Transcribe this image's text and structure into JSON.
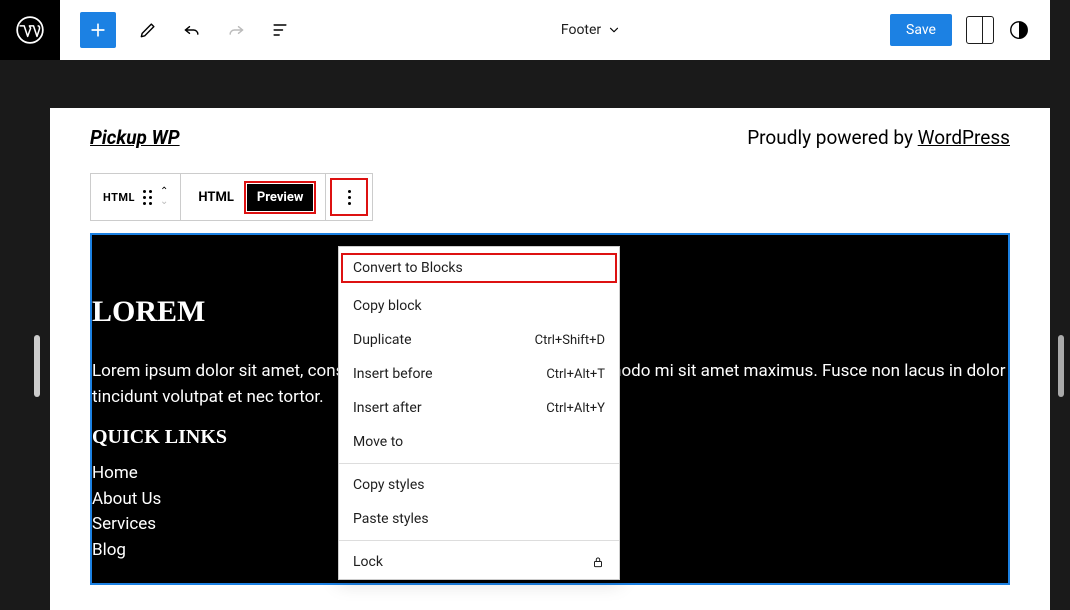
{
  "topbar": {
    "title_label": "Footer",
    "save_label": "Save"
  },
  "site": {
    "title": "Pickup WP",
    "powered_prefix": "Proudly powered by ",
    "powered_link": "WordPress"
  },
  "toolbar": {
    "type_label": "HTML",
    "html_btn": "HTML",
    "preview_btn": "Preview"
  },
  "menu": {
    "items": [
      {
        "label": "Convert to Blocks",
        "kbd": "",
        "highlight": true
      },
      {
        "label": "Copy block",
        "kbd": ""
      },
      {
        "label": "Duplicate",
        "kbd": "Ctrl+Shift+D"
      },
      {
        "label": "Insert before",
        "kbd": "Ctrl+Alt+T"
      },
      {
        "label": "Insert after",
        "kbd": "Ctrl+Alt+Y"
      },
      {
        "label": "Move to",
        "kbd": ""
      }
    ],
    "group2": [
      {
        "label": "Copy styles",
        "kbd": ""
      },
      {
        "label": "Paste styles",
        "kbd": ""
      }
    ],
    "group3": [
      {
        "label": "Lock",
        "icon": "lock"
      }
    ]
  },
  "block": {
    "heading": "LOREM",
    "paragraph": "Lorem ipsum dolor sit amet, consectetur adipiscing elit. Nullam commodo mi sit amet maximus. Fusce non lacus in dolor tincidunt volutpat et nec tortor.",
    "quick_heading": "QUICK LINKS",
    "links": [
      "Home",
      "About Us",
      "Services",
      "Blog"
    ]
  }
}
